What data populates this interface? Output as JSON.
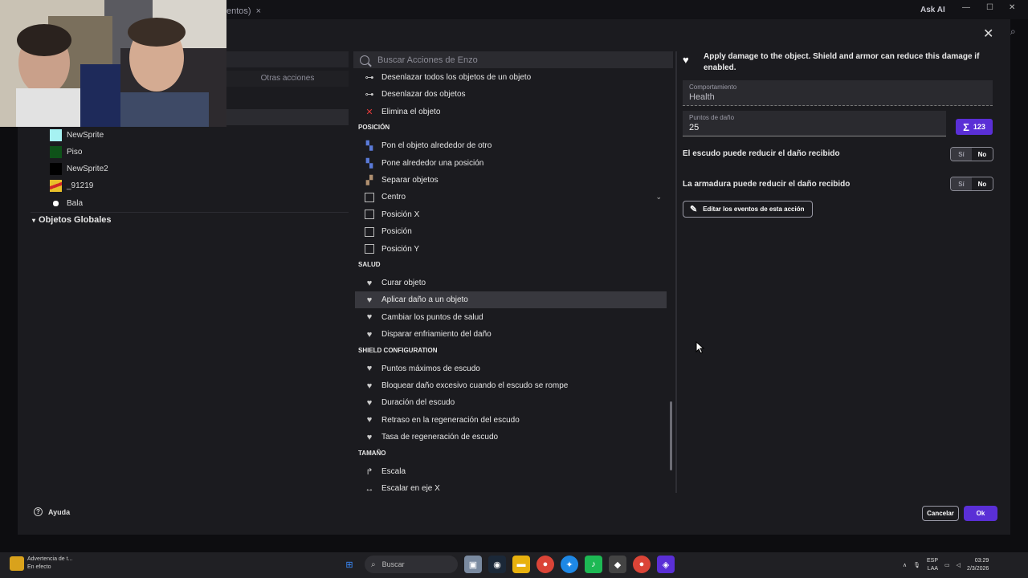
{
  "topbar": {
    "tab_fragment": "entos)",
    "tab_close": "×",
    "ask_ai": "Ask AI",
    "minimize": "—",
    "maximize": "☐",
    "close": "✕"
  },
  "left_panel": {
    "other_actions_tab": "Otras acciones",
    "objects": [
      {
        "name": "NewSprite",
        "color": "#a6f2f2"
      },
      {
        "name": "Piso",
        "color": "#0e5219"
      },
      {
        "name": "NewSprite2",
        "color": "#000000"
      },
      {
        "name": "_91219",
        "color": "#e8c02a"
      },
      {
        "name": "Bala",
        "color": "#ffffff"
      }
    ],
    "global_objects_label": "Objetos Globales",
    "global_caret": "▾"
  },
  "search": {
    "placeholder": "Buscar Acciones de Enzo"
  },
  "actions": [
    {
      "kind": "item",
      "label": "Desenlazar todos los objetos de un objeto",
      "icon": "unlink-icon",
      "glyph": "⊶"
    },
    {
      "kind": "item",
      "label": "Desenlazar dos objetos",
      "icon": "unlink-icon",
      "glyph": "⊶"
    },
    {
      "kind": "item",
      "label": "Elimina el objeto",
      "icon": "delete-x-icon",
      "glyph": "✕"
    },
    {
      "kind": "section",
      "label": "POSICIÓN"
    },
    {
      "kind": "item",
      "label": "Pon el objeto alrededor de otro",
      "icon": "position-icon",
      "glyph": "▚"
    },
    {
      "kind": "item",
      "label": "Pone alrededor una posición",
      "icon": "position-icon",
      "glyph": "▚"
    },
    {
      "kind": "item",
      "label": "Separar objetos",
      "icon": "separate-icon",
      "glyph": "▞"
    },
    {
      "kind": "item",
      "label": "Centro",
      "icon": "square-icon",
      "glyph": "",
      "chevron": "⌄"
    },
    {
      "kind": "item",
      "label": "Posición X",
      "icon": "square-icon",
      "glyph": ""
    },
    {
      "kind": "item",
      "label": "Posición",
      "icon": "square-icon",
      "glyph": ""
    },
    {
      "kind": "item",
      "label": "Posición Y",
      "icon": "square-icon",
      "glyph": ""
    },
    {
      "kind": "section",
      "label": "SALUD"
    },
    {
      "kind": "item",
      "label": "Curar objeto",
      "icon": "heart-icon",
      "glyph": "♥"
    },
    {
      "kind": "item",
      "label": "Aplicar daño a un objeto",
      "icon": "heart-icon",
      "glyph": "♥",
      "selected": true
    },
    {
      "kind": "item",
      "label": "Cambiar los puntos de salud",
      "icon": "heart-icon",
      "glyph": "♥"
    },
    {
      "kind": "item",
      "label": "Disparar enfriamiento del daño",
      "icon": "heart-icon",
      "glyph": "♥"
    },
    {
      "kind": "section",
      "label": "SHIELD CONFIGURATION"
    },
    {
      "kind": "item",
      "label": "Puntos máximos de escudo",
      "icon": "heart-icon",
      "glyph": "♥"
    },
    {
      "kind": "item",
      "label": "Bloquear daño excesivo cuando el escudo se rompe",
      "icon": "heart-icon",
      "glyph": "♥"
    },
    {
      "kind": "item",
      "label": "Duración del escudo",
      "icon": "heart-icon",
      "glyph": "♥"
    },
    {
      "kind": "item",
      "label": "Retraso en la regeneración del escudo",
      "icon": "heart-icon",
      "glyph": "♥"
    },
    {
      "kind": "item",
      "label": "Tasa de regeneración de escudo",
      "icon": "heart-icon",
      "glyph": "♥"
    },
    {
      "kind": "section",
      "label": "TAMAÑO"
    },
    {
      "kind": "item",
      "label": "Escala",
      "icon": "scale-icon",
      "glyph": "↱"
    },
    {
      "kind": "item",
      "label": "Escalar en eje X",
      "icon": "scale-x-icon",
      "glyph": "↔"
    }
  ],
  "details": {
    "description": "Apply damage to the object. Shield and armor can reduce this damage if enabled.",
    "behavior_label": "Comportamiento",
    "behavior_value": "Health",
    "damage_label": "Puntos de daño",
    "damage_value": "25",
    "sigma_glyph": "Σ",
    "sigma_text": "123",
    "shield_label": "El escudo puede reducir el daño recibido",
    "armor_label": "La armadura puede reducir el daño recibido",
    "yes": "Sí",
    "no": "No",
    "edit_events": "Editar los eventos de esta acción"
  },
  "footer": {
    "help": "Ayuda",
    "cancel": "Cancelar",
    "ok": "Ok"
  },
  "taskbar": {
    "notification_title": "Advertencia de t...",
    "notification_sub": "En efecto",
    "search_label": "Buscar",
    "lang_top": "ESP",
    "lang_bottom": "LAA",
    "time": "03:29",
    "date": "2/3/2026"
  },
  "colors": {
    "accent": "#5a2fd6",
    "background": "#1b1b1f"
  }
}
